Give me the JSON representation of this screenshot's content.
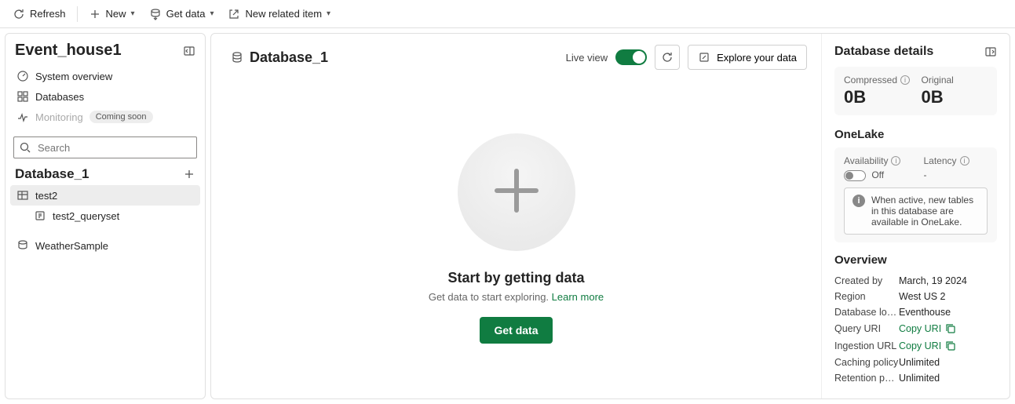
{
  "toolbar": {
    "refresh": "Refresh",
    "new": "New",
    "get_data": "Get data",
    "new_related": "New related item"
  },
  "sidebar": {
    "title": "Event_house1",
    "nav": [
      {
        "label": "System overview"
      },
      {
        "label": "Databases"
      },
      {
        "label": "Monitoring",
        "badge": "Coming soon"
      }
    ],
    "search_placeholder": "Search",
    "database": "Database_1",
    "tree": [
      {
        "label": "test2",
        "selected": true
      },
      {
        "label": "test2_queryset",
        "child": true
      },
      {
        "label": "WeatherSample"
      }
    ]
  },
  "center": {
    "db_title": "Database_1",
    "live_view": "Live view",
    "explore": "Explore your data",
    "empty_title": "Start by getting data",
    "empty_sub": "Get data to start exploring. ",
    "learn_more": "Learn more",
    "get_data_btn": "Get data"
  },
  "details": {
    "title": "Database details",
    "compressed_label": "Compressed",
    "compressed_value": "0B",
    "original_label": "Original",
    "original_value": "0B",
    "onelake_title": "OneLake",
    "availability_label": "Availability",
    "availability_value": "Off",
    "latency_label": "Latency",
    "latency_value": "-",
    "onelake_note": "When active, new tables in this database are available in OneLake.",
    "overview_title": "Overview",
    "rows": [
      {
        "k": "Created by",
        "v": "March, 19 2024"
      },
      {
        "k": "Region",
        "v": "West US 2"
      },
      {
        "k": "Database locati...",
        "v": "Eventhouse"
      },
      {
        "k": "Query URI",
        "v": "Copy URI",
        "link": true
      },
      {
        "k": "Ingestion URL",
        "v": "Copy URI",
        "link": true
      },
      {
        "k": "Caching policy",
        "v": "Unlimited"
      },
      {
        "k": "Retention policy",
        "v": "Unlimited"
      }
    ]
  }
}
